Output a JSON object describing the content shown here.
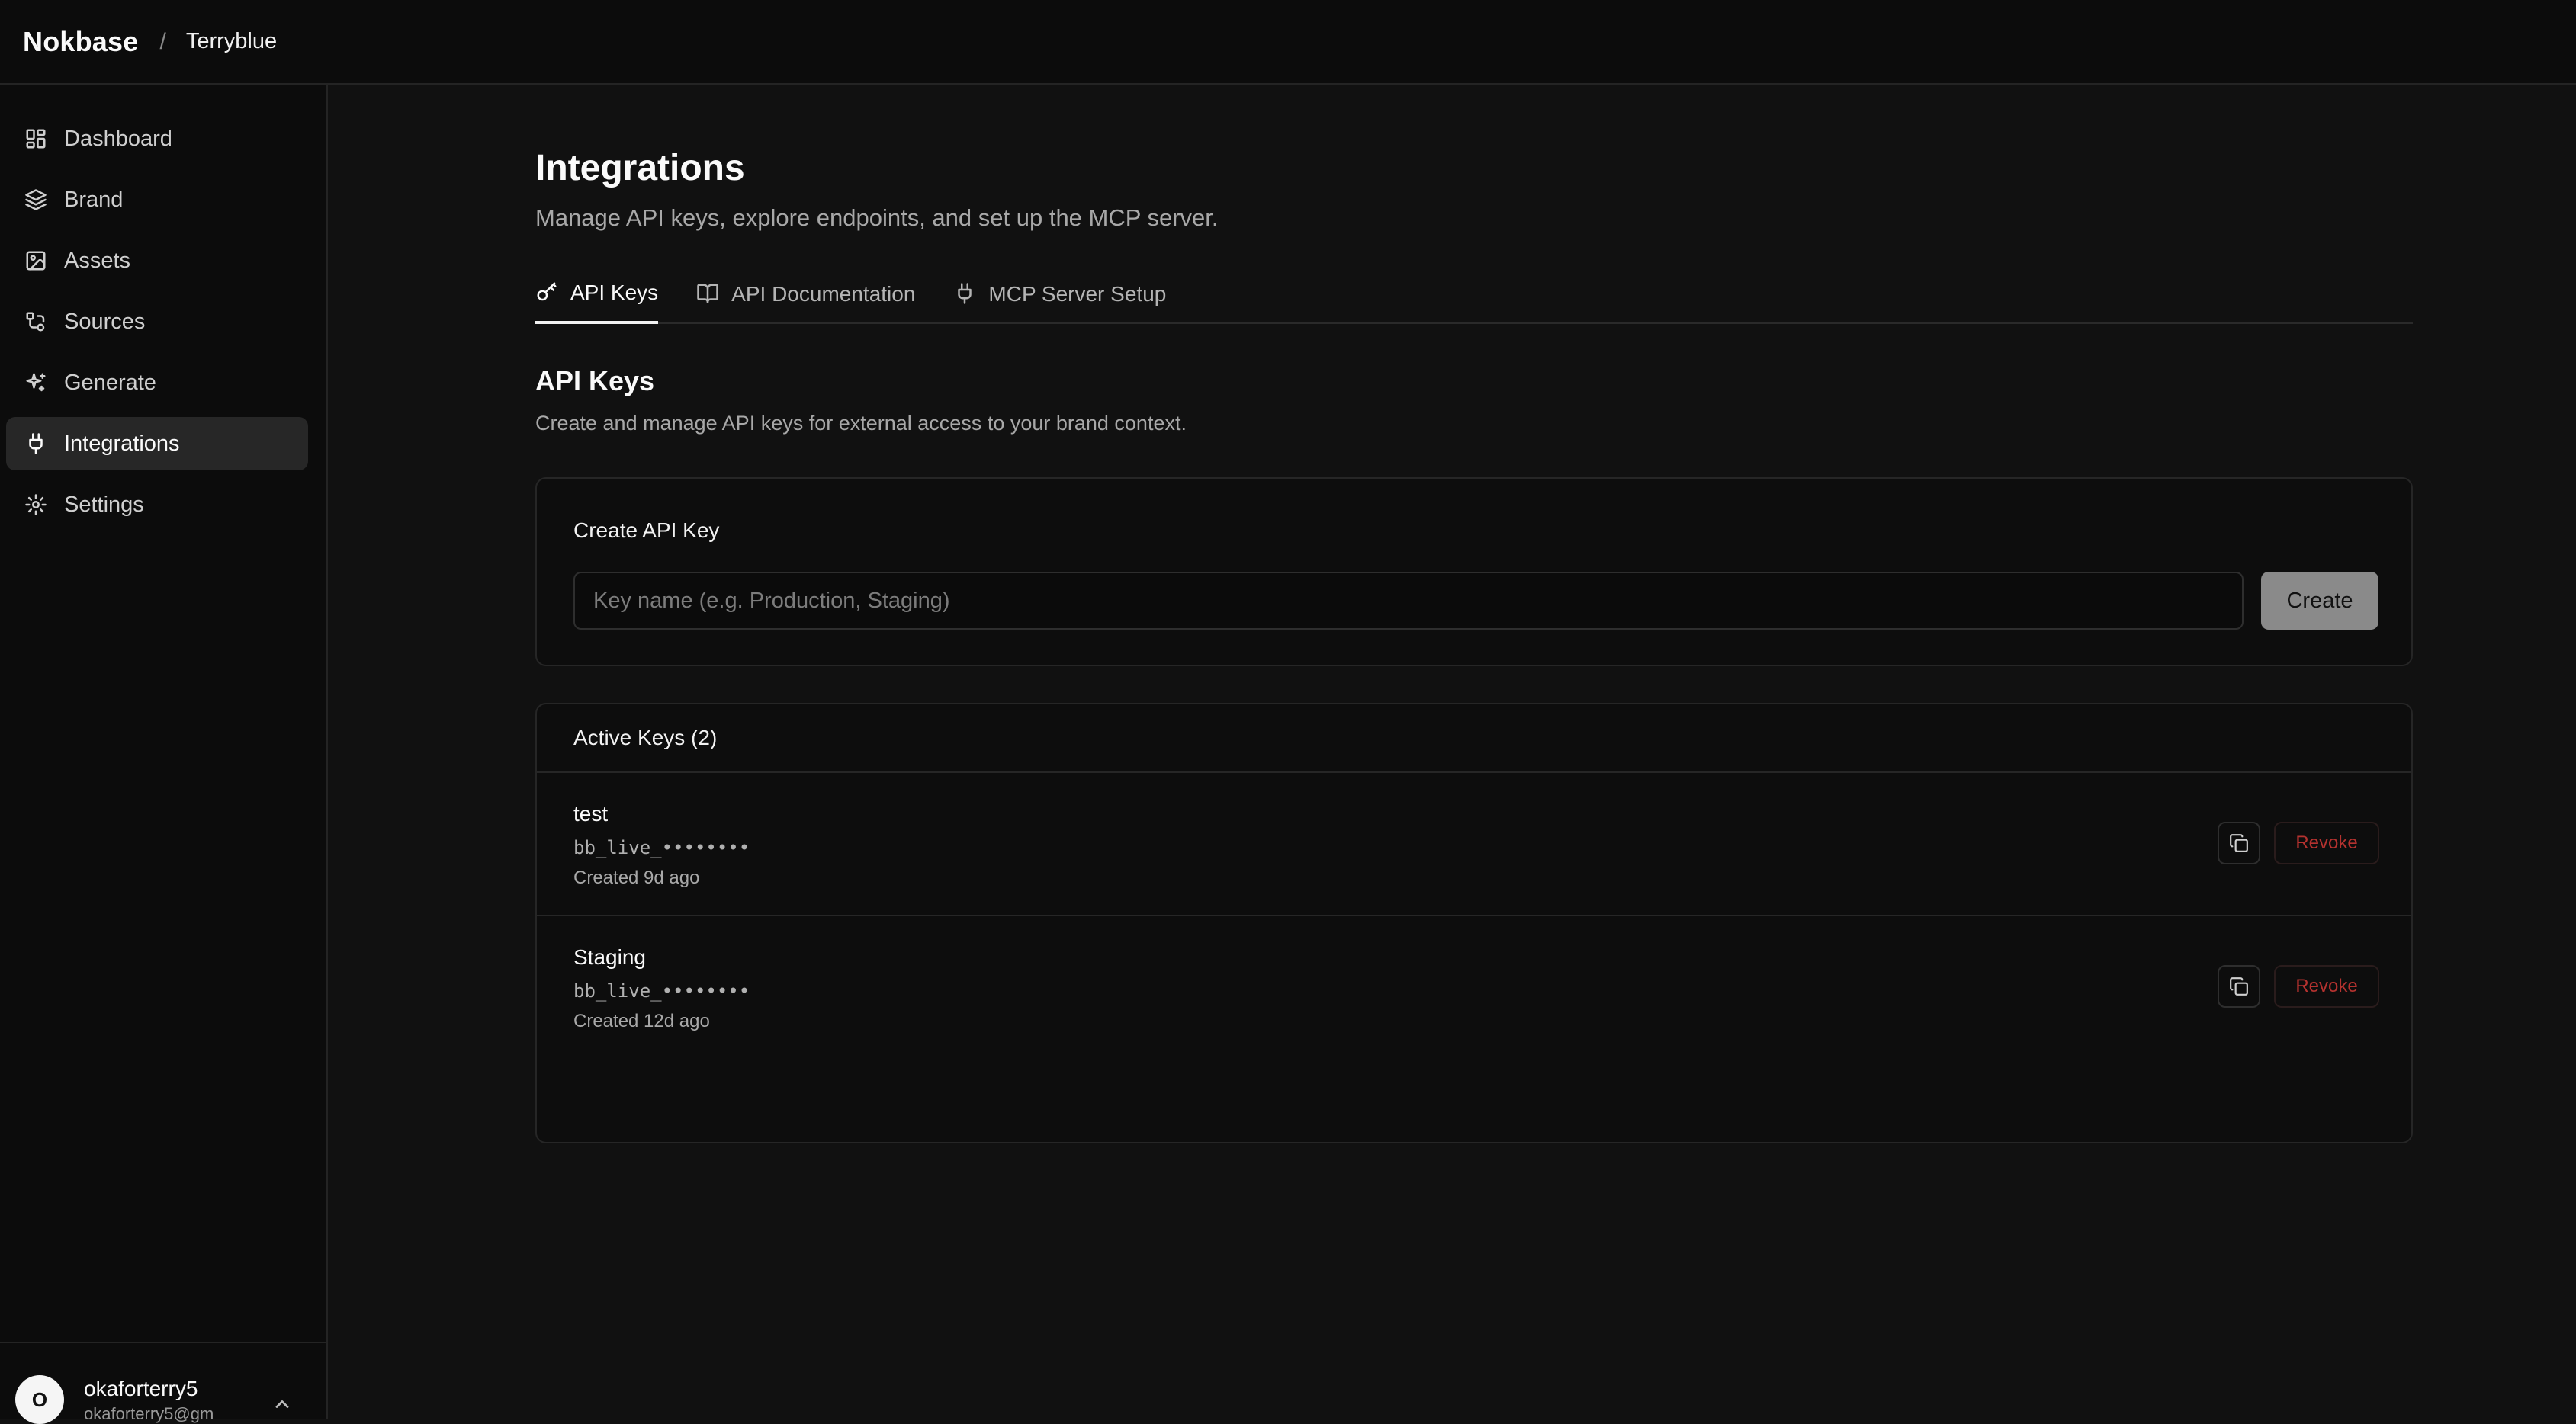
{
  "topbar": {
    "brand": "Nokbase",
    "separator": "/",
    "workspace": "Terryblue"
  },
  "sidebar": {
    "items": [
      {
        "label": "Dashboard",
        "icon": "dashboard-icon"
      },
      {
        "label": "Brand",
        "icon": "layers-icon"
      },
      {
        "label": "Assets",
        "icon": "image-icon"
      },
      {
        "label": "Sources",
        "icon": "sources-icon"
      },
      {
        "label": "Generate",
        "icon": "sparkles-icon"
      },
      {
        "label": "Integrations",
        "icon": "plug-icon",
        "active": true
      },
      {
        "label": "Settings",
        "icon": "gear-icon"
      }
    ],
    "user": {
      "initial": "O",
      "name": "okaforterry5",
      "email": "okaforterry5@gm",
      "chevron": "chevron-up-icon"
    }
  },
  "main": {
    "title": "Integrations",
    "subtitle": "Manage API keys, explore endpoints, and set up the MCP server.",
    "tabs": [
      {
        "label": "API Keys",
        "icon": "key-icon",
        "active": true
      },
      {
        "label": "API Documentation",
        "icon": "book-icon"
      },
      {
        "label": "MCP Server Setup",
        "icon": "plug-icon"
      }
    ],
    "section": {
      "title": "API Keys",
      "description": "Create and manage API keys for external access to your brand context."
    },
    "create": {
      "label": "Create API Key",
      "placeholder": "Key name (e.g. Production, Staging)",
      "value": "",
      "button": "Create"
    },
    "keys": {
      "header": "Active Keys (2)",
      "items": [
        {
          "name": "test",
          "prefix": "bb_live_••••••••",
          "created": "Created 9d ago",
          "revoke": "Revoke"
        },
        {
          "name": "Staging",
          "prefix": "bb_live_••••••••",
          "created": "Created 12d ago",
          "revoke": "Revoke"
        }
      ]
    }
  },
  "colors": {
    "background": "#111111",
    "surface": "#0c0c0c",
    "active_nav": "#272727",
    "create_button": "#8a8a8a",
    "danger": "#b5322f"
  }
}
